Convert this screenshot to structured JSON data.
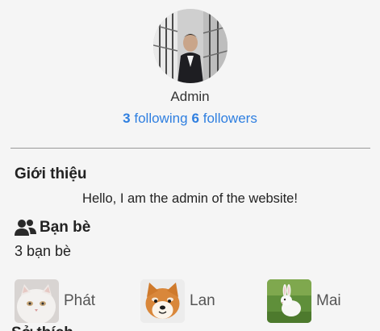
{
  "profile": {
    "username": "Admin",
    "following_count": "3",
    "following_label": "following",
    "followers_count": "6",
    "followers_label": "followers"
  },
  "intro": {
    "title": "Giới thiệu",
    "text": "Hello, I am the admin of the website!"
  },
  "friends": {
    "title": "Bạn bè",
    "icon": "users-icon",
    "count_text": "3 bạn bè",
    "items": [
      {
        "name": "Phát",
        "picture": "white-cat-photo"
      },
      {
        "name": "Lan",
        "picture": "shiba-dog-photo"
      },
      {
        "name": "Mai",
        "picture": "white-rabbit-photo"
      }
    ]
  },
  "next_section": {
    "title": "Sở thích"
  },
  "colors": {
    "accent": "#2f7fe0",
    "divider": "#9a9a9a",
    "background": "#f5f5f5"
  }
}
